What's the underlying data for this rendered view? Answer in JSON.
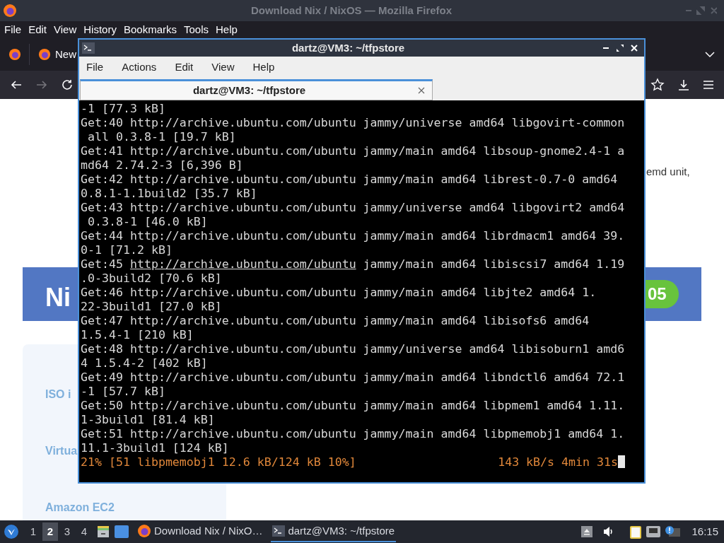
{
  "firefox": {
    "title": "Download Nix / NixOS — Mozilla Firefox",
    "menu": [
      "File",
      "Edit",
      "View",
      "History",
      "Bookmarks",
      "Tools",
      "Help"
    ],
    "tab": {
      "label": "New"
    },
    "page": {
      "paragraph_tail": "emd unit,",
      "banner_title": "Ni",
      "version_badge": "05",
      "links": [
        "ISO i",
        "Virtua",
        "Amazon EC2"
      ]
    }
  },
  "terminal": {
    "title": "dartz@VM3: ~/tfpstore",
    "menu": [
      "File",
      "Actions",
      "Edit",
      "View",
      "Help"
    ],
    "tab": {
      "label": "dartz@VM3: ~/tfpstore"
    },
    "lines": [
      {
        "text": "-1 [77.3 kB]"
      },
      {
        "text": "Get:40 http://archive.ubuntu.com/ubuntu jammy/universe amd64 libgovirt-common"
      },
      {
        "text": " all 0.3.8-1 [19.7 kB]"
      },
      {
        "text": "Get:41 http://archive.ubuntu.com/ubuntu jammy/main amd64 libsoup-gnome2.4-1 a"
      },
      {
        "text": "md64 2.74.2-3 [6,396 B]"
      },
      {
        "text": "Get:42 http://archive.ubuntu.com/ubuntu jammy/main amd64 librest-0.7-0 amd64"
      },
      {
        "text": "0.8.1-1.1build2 [35.7 kB]"
      },
      {
        "text": "Get:43 http://archive.ubuntu.com/ubuntu jammy/universe amd64 libgovirt2 amd64"
      },
      {
        "text": " 0.3.8-1 [46.0 kB]"
      },
      {
        "text": "Get:44 http://archive.ubuntu.com/ubuntu jammy/main amd64 librdmacm1 amd64 39."
      },
      {
        "text": "0-1 [71.2 kB]"
      },
      {
        "text": "Get:45 ",
        "link": "http://archive.ubuntu.com/ubuntu",
        "after": " jammy/main amd64 libiscsi7 amd64 1.19"
      },
      {
        "text": ".0-3build2 [70.6 kB]"
      },
      {
        "text": "Get:46 http://archive.ubuntu.com/ubuntu jammy/main amd64 libjte2 amd64 1."
      },
      {
        "text": "22-3build1 [27.0 kB]"
      },
      {
        "text": "Get:47 http://archive.ubuntu.com/ubuntu jammy/main amd64 libisofs6 amd64"
      },
      {
        "text": "1.5.4-1 [210 kB]"
      },
      {
        "text": "Get:48 http://archive.ubuntu.com/ubuntu jammy/universe amd64 libisoburn1 amd6"
      },
      {
        "text": "4 1.5.4-2 [402 kB]"
      },
      {
        "text": "Get:49 http://archive.ubuntu.com/ubuntu jammy/main amd64 libndctl6 amd64 72.1"
      },
      {
        "text": "-1 [57.7 kB]"
      },
      {
        "text": "Get:50 http://archive.ubuntu.com/ubuntu jammy/main amd64 libpmem1 amd64 1.11."
      },
      {
        "text": "1-3build1 [81.4 kB]"
      },
      {
        "text": "Get:51 http://archive.ubuntu.com/ubuntu jammy/main amd64 libpmemobj1 amd64 1."
      },
      {
        "text": "11.1-3build1 [124 kB]"
      }
    ],
    "progress": {
      "status": "21% [51 libpmemobj1 12.6 kB/124 kB 10%]",
      "rate": "143 kB/s 4min 31s"
    }
  },
  "taskbar": {
    "workspaces": [
      {
        "label": "1",
        "selected": false
      },
      {
        "label": "2",
        "selected": true
      },
      {
        "label": "3",
        "selected": false
      },
      {
        "label": "4",
        "selected": false
      }
    ],
    "tasks": [
      {
        "kind": "firefox",
        "label": "Download Nix / NixO…",
        "selected": false
      },
      {
        "kind": "terminal",
        "label": "dartz@VM3: ~/tfpstore",
        "selected": true
      }
    ],
    "clock": "16:15"
  }
}
